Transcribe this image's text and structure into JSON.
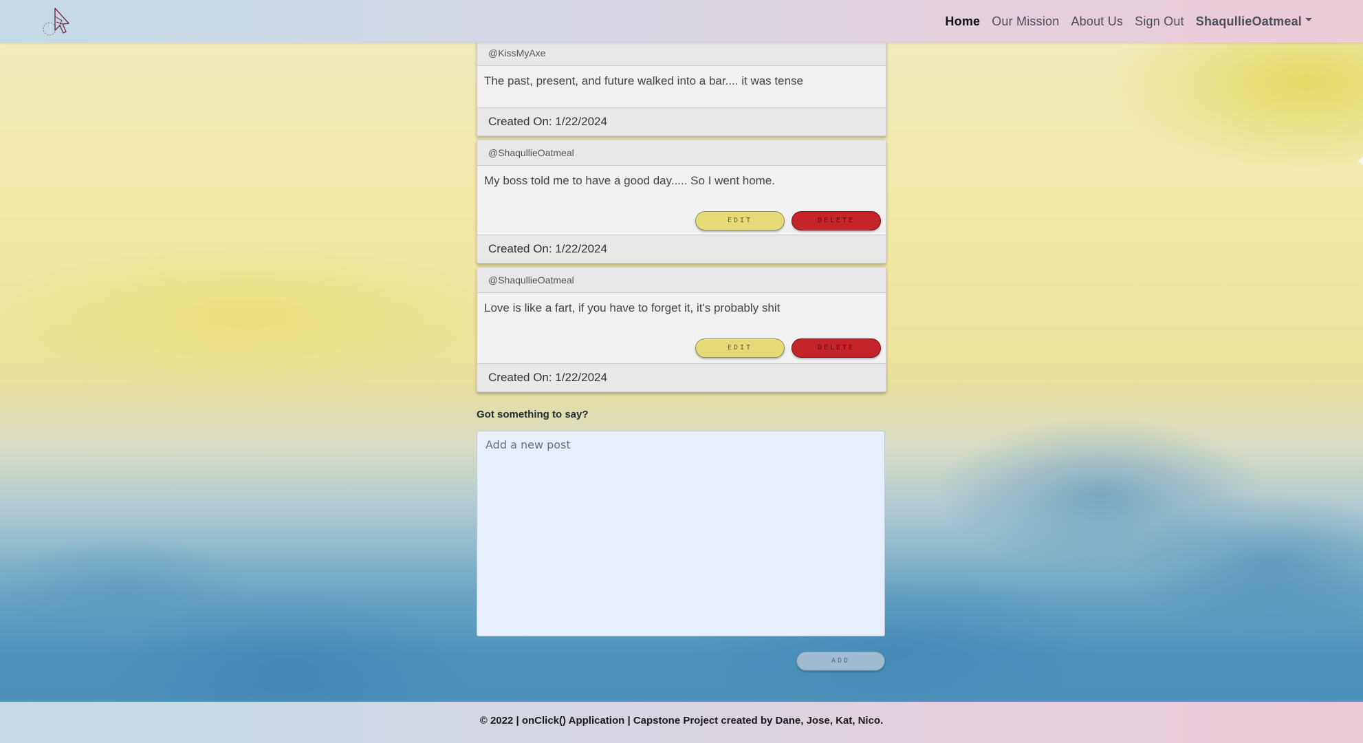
{
  "nav": {
    "logo_icon": "cursor-pointer-logo",
    "links": [
      "Home",
      "Our Mission",
      "About Us",
      "Sign Out"
    ],
    "user": "ShaqullieOatmeal"
  },
  "posts": [
    {
      "author": "@KissMyAxe",
      "body": "The past, present, and future walked into a bar.... it was tense",
      "created": "Created On: 1/22/2024",
      "can_edit": false
    },
    {
      "author": "@ShaqullieOatmeal",
      "body": "My boss told me to have a good day..... So I went home.",
      "created": "Created On: 1/22/2024",
      "can_edit": true
    },
    {
      "author": "@ShaqullieOatmeal",
      "body": "Love is like a fart, if you have to forget it, it's probably shit",
      "created": "Created On: 1/22/2024",
      "can_edit": true
    }
  ],
  "buttons": {
    "edit": "EDIT",
    "delete": "DELETE",
    "add": "ADD"
  },
  "compose": {
    "label": "Got something to say?",
    "placeholder": "Add a new post",
    "value": ""
  },
  "footer": {
    "text": "© 2022 | onClick() Application | Capstone Project created by Dane, Jose, Kat, Nico."
  },
  "colors": {
    "edit_button": "#e6da78",
    "delete_button": "#c4242a",
    "add_button": "#9fbcd0",
    "compose_bg": "#e6effb"
  }
}
